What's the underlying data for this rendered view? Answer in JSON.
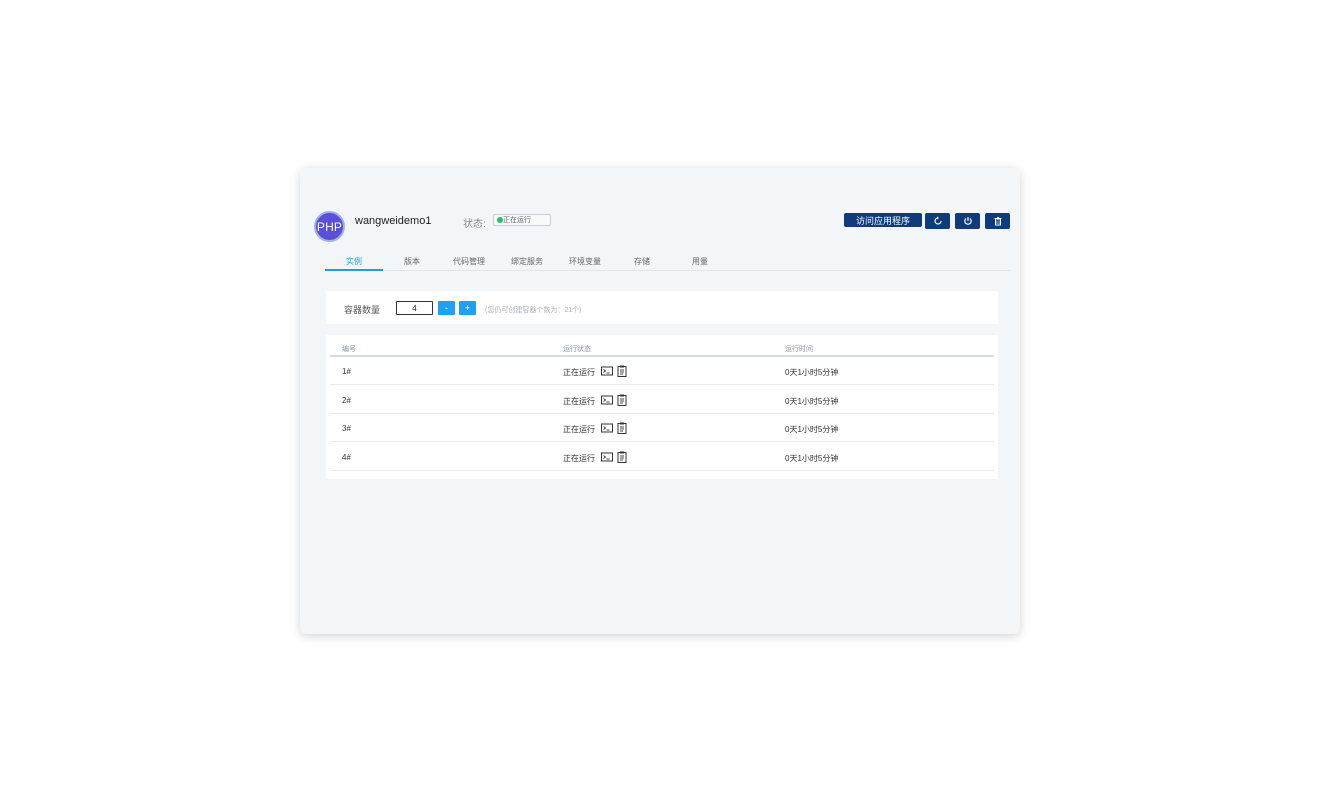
{
  "header": {
    "avatar_text": "PHP",
    "app_name": "wangweidemo1",
    "status_label": "状态:",
    "status_value": "正在运行",
    "visit_button": "访问应用程序",
    "icons": [
      "refresh-icon",
      "power-icon",
      "trash-icon"
    ]
  },
  "tabs": [
    {
      "label": "实例",
      "active": true
    },
    {
      "label": "版本"
    },
    {
      "label": "代码管理"
    },
    {
      "label": "绑定服务"
    },
    {
      "label": "环境变量"
    },
    {
      "label": "存储"
    },
    {
      "label": "用量"
    }
  ],
  "quantity": {
    "label": "容器数量",
    "value": "4",
    "minus": "-",
    "plus": "+",
    "hint": "(您仍可创建容器个数为：21个)"
  },
  "table": {
    "columns": [
      "编号",
      "运行状态",
      "运行时间"
    ],
    "rows": [
      {
        "id": "1#",
        "status": "正在运行",
        "uptime": "0天1小时5分钟"
      },
      {
        "id": "2#",
        "status": "正在运行",
        "uptime": "0天1小时5分钟"
      },
      {
        "id": "3#",
        "status": "正在运行",
        "uptime": "0天1小时5分钟"
      },
      {
        "id": "4#",
        "status": "正在运行",
        "uptime": "0天1小时5分钟"
      }
    ]
  },
  "colors": {
    "primary": "#0f3b7a",
    "accent": "#1d9bf0",
    "stepper": "#1da1f2",
    "status_dot": "#22c55e",
    "avatar": "#5a4fd6"
  }
}
